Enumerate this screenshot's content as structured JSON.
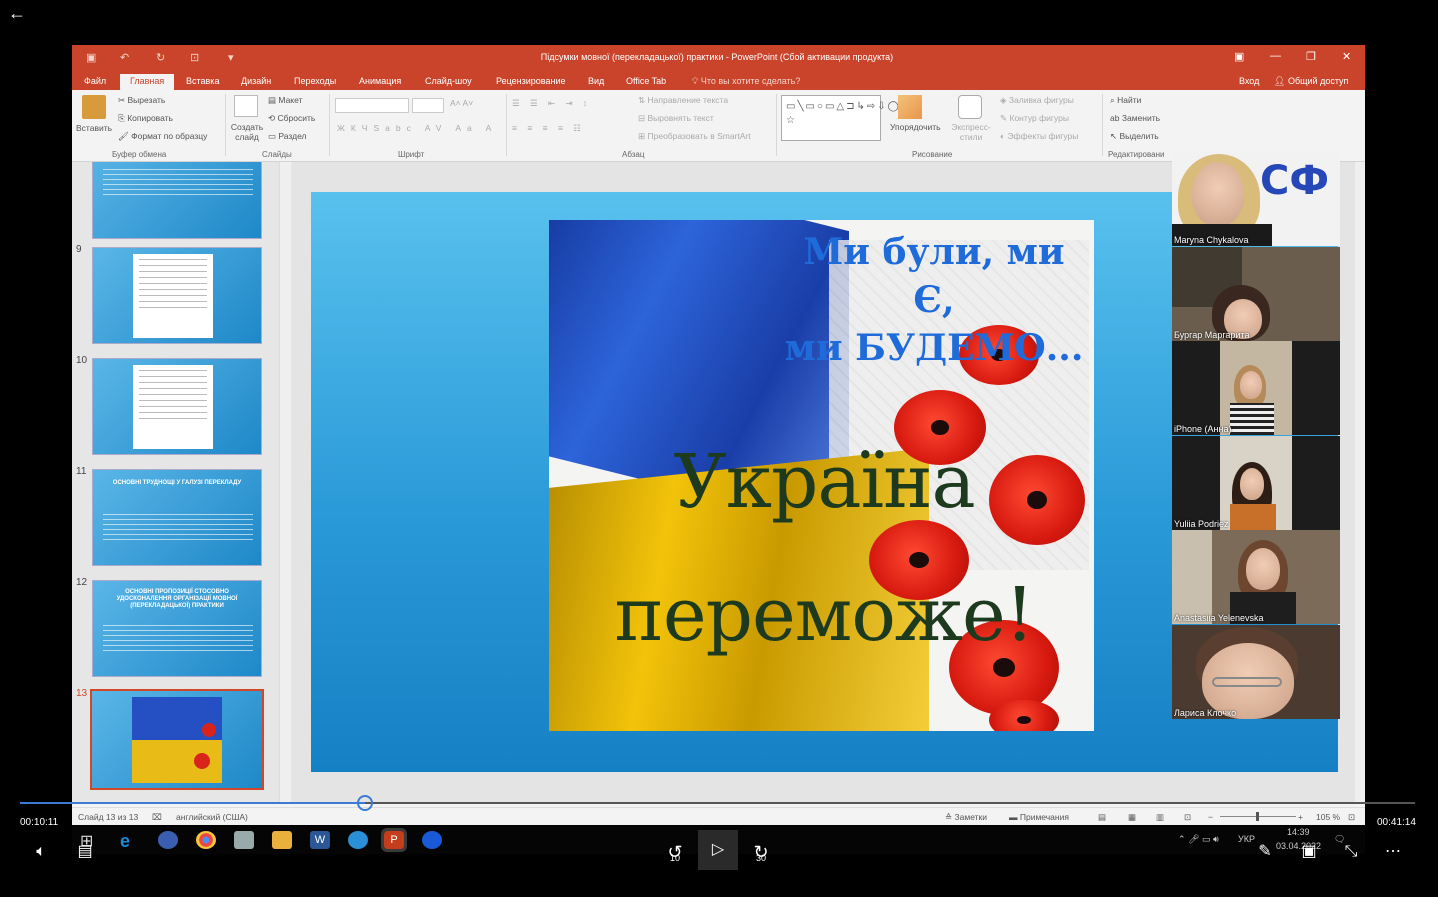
{
  "player": {
    "time_current": "00:10:11",
    "time_total": "00:41:14",
    "progress": 0.247,
    "skip_back": "10",
    "skip_fwd": "30"
  },
  "ppt": {
    "window_title": "Підсумки мовної (перекладацької) практики - PowerPoint (Сбой активации продукта)",
    "tabs": [
      "Файл",
      "Главная",
      "Вставка",
      "Дизайн",
      "Переходы",
      "Анимация",
      "Слайд-шоу",
      "Рецензирование",
      "Вид",
      "Office Tab"
    ],
    "tell_me": "Что вы хотите сделать?",
    "signin": "Вход",
    "share": "Общий доступ",
    "ribbon": {
      "paste": "Вставить",
      "cut": "Вырезать",
      "copy": "Копировать",
      "format_painter": "Формат по образцу",
      "new_slide": "Создать слайд",
      "layout": "Макет",
      "reset": "Сбросить",
      "section": "Раздел",
      "text_direction": "Направление текста",
      "align_text": "Выровнять текст",
      "convert_smartart": "Преобразовать в SmartArt",
      "arrange": "Упорядочить",
      "quick_styles": "Экспресс-стили",
      "shape_fill": "Заливка фигуры",
      "shape_outline": "Контур фигуры",
      "shape_effects": "Эффекты фигуры",
      "find": "Найти",
      "replace": "Заменить",
      "select": "Выделить",
      "groups": {
        "clipboard": "Буфер обмена",
        "slides": "Слайды",
        "font": "Шрифт",
        "paragraph": "Абзац",
        "drawing": "Рисование",
        "editing": "Редактировани"
      }
    },
    "thumbnails": [
      {
        "num": "9",
        "caption": ""
      },
      {
        "num": "10",
        "caption": ""
      },
      {
        "num": "11",
        "caption": "ОСНОВНІ ТРУДНОЩІ У ГАЛУЗІ ПЕРЕКЛАДУ"
      },
      {
        "num": "12",
        "caption": "ОСНОВНІ ПРОПОЗИЦІЇ СТОСОВНО УДОСКОНАЛЕННЯ ОРГАНІЗАЦІЇ МОВНОЇ (ПЕРЕКЛАДАЦЬКОЇ) ПРАКТИКИ"
      },
      {
        "num": "13",
        "caption": ""
      }
    ],
    "slide": {
      "line1": "Ми були, ми Є,",
      "line2": "ми БУДЕМО...",
      "line3": "Україна",
      "line4": "переможе!"
    },
    "status": {
      "slide_count": "Слайд 13 из 13",
      "language": "английский (США)",
      "notes": "Заметки",
      "comments": "Примечания",
      "zoom": "105 %"
    }
  },
  "participants": [
    "Maryna Chykalova",
    "Бургар Маргарита",
    "iPhone (Анна)",
    "Yuliia Podriez",
    "Anastasiia Yelenevska",
    "Лариса Клочко"
  ],
  "tray": {
    "lang": "УКР",
    "time": "14:39",
    "date": "03.04.2022"
  },
  "colors": {
    "ppt_accent": "#c9442b",
    "progress": "#3a7bd5"
  }
}
